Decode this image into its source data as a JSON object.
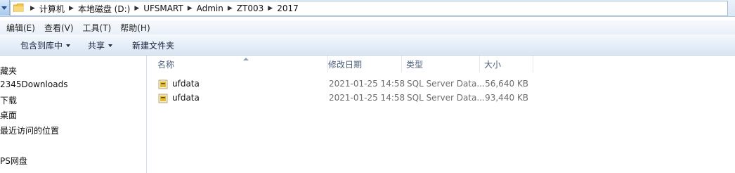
{
  "address_bar": {
    "path": [
      "计算机",
      "本地磁盘 (D:)",
      "UFSMART",
      "Admin",
      "ZT003",
      "2017"
    ],
    "separator": "▶"
  },
  "menu": [
    "编辑(E)",
    "查看(V)",
    "工具(T)",
    "帮助(H)"
  ],
  "toolbar": {
    "include_in_library": "包含到库中",
    "share": "共享",
    "new_folder": "新建文件夹"
  },
  "nav_pane": {
    "items": [
      "藏夹",
      "2345Downloads",
      "下载",
      "桌面",
      "最近访问的位置",
      "PS网盘"
    ]
  },
  "columns": {
    "name": "名称",
    "modified": "修改日期",
    "type": "类型",
    "size": "大小"
  },
  "files": [
    {
      "name": "ufdata",
      "modified": "2021-01-25 14:58",
      "type": "SQL Server Data...",
      "size": "56,640 KB"
    },
    {
      "name": "ufdata",
      "modified": "2021-01-25 14:58",
      "type": "SQL Server Data...",
      "size": "93,440 KB"
    }
  ],
  "colors": {
    "accent": "#1c4f8f",
    "toolbar_bg": "#e6eef8",
    "folder": "#f2c54b"
  }
}
